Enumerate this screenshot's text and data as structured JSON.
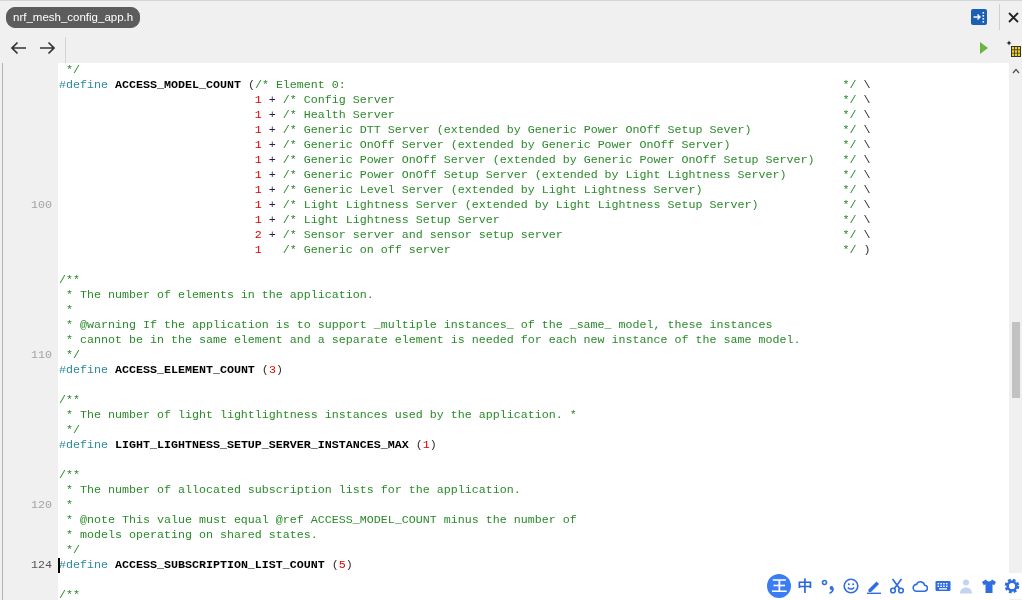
{
  "tab": {
    "label": "nrf_mesh_config_app.h",
    "selected": true
  },
  "editor": {
    "lines": [
      {
        "code": [
          {
            "kind": "comment",
            "text": " */"
          }
        ],
        "caret": false
      },
      {
        "code": [
          {
            "kind": "directive",
            "text": "#define "
          },
          {
            "kind": "macro",
            "text": "ACCESS_MODEL_COUNT"
          },
          {
            "kind": "plain",
            "text": " ("
          },
          {
            "kind": "comment",
            "text": "/* Element 0:"
          }
        ],
        "tail": [
          {
            "kind": "comment",
            "text": "*/"
          },
          {
            "kind": "plain",
            "text": " \\"
          }
        ],
        "caret": false
      },
      {
        "code": [
          {
            "kind": "number",
            "text": "                            1"
          },
          {
            "kind": "operator",
            "text": " + "
          },
          {
            "kind": "comment",
            "text": "/* Config Server"
          }
        ],
        "tail": [
          {
            "kind": "comment",
            "text": "*/"
          },
          {
            "kind": "plain",
            "text": " \\"
          }
        ],
        "caret": false
      },
      {
        "code": [
          {
            "kind": "number",
            "text": "                            1"
          },
          {
            "kind": "operator",
            "text": " + "
          },
          {
            "kind": "comment",
            "text": "/* Health Server"
          }
        ],
        "tail": [
          {
            "kind": "comment",
            "text": "*/"
          },
          {
            "kind": "plain",
            "text": " \\"
          }
        ],
        "caret": false
      },
      {
        "code": [
          {
            "kind": "number",
            "text": "                            1"
          },
          {
            "kind": "operator",
            "text": " + "
          },
          {
            "kind": "comment",
            "text": "/* Generic DTT Server (extended by Generic Power OnOff Setup Sever)"
          }
        ],
        "tail": [
          {
            "kind": "comment",
            "text": "*/"
          },
          {
            "kind": "plain",
            "text": " \\"
          }
        ],
        "caret": false
      },
      {
        "code": [
          {
            "kind": "number",
            "text": "                            1"
          },
          {
            "kind": "operator",
            "text": " + "
          },
          {
            "kind": "comment",
            "text": "/* Generic OnOff Server (extended by Generic Power OnOff Server)"
          }
        ],
        "tail": [
          {
            "kind": "comment",
            "text": "*/"
          },
          {
            "kind": "plain",
            "text": " \\"
          }
        ],
        "caret": false
      },
      {
        "code": [
          {
            "kind": "number",
            "text": "                            1"
          },
          {
            "kind": "operator",
            "text": " + "
          },
          {
            "kind": "comment",
            "text": "/* Generic Power OnOff Server (extended by Generic Power OnOff Setup Server)"
          }
        ],
        "tail": [
          {
            "kind": "comment",
            "text": "*/"
          },
          {
            "kind": "plain",
            "text": " \\"
          }
        ],
        "caret": false
      },
      {
        "code": [
          {
            "kind": "number",
            "text": "                            1"
          },
          {
            "kind": "operator",
            "text": " + "
          },
          {
            "kind": "comment",
            "text": "/* Generic Power OnOff Setup Server (extended by Light Lightness Server)"
          }
        ],
        "tail": [
          {
            "kind": "comment",
            "text": "*/"
          },
          {
            "kind": "plain",
            "text": " \\"
          }
        ],
        "caret": false
      },
      {
        "code": [
          {
            "kind": "number",
            "text": "                            1"
          },
          {
            "kind": "operator",
            "text": " + "
          },
          {
            "kind": "comment",
            "text": "/* Generic Level Server (extended by Light Lightness Server)"
          }
        ],
        "tail": [
          {
            "kind": "comment",
            "text": "*/"
          },
          {
            "kind": "plain",
            "text": " \\"
          }
        ],
        "caret": false
      },
      {
        "number": "100",
        "code": [
          {
            "kind": "number",
            "text": "                            1"
          },
          {
            "kind": "operator",
            "text": " + "
          },
          {
            "kind": "comment",
            "text": "/* Light Lightness Server (extended by Light Lightness Setup Server)"
          }
        ],
        "tail": [
          {
            "kind": "comment",
            "text": "*/"
          },
          {
            "kind": "plain",
            "text": " \\"
          }
        ],
        "caret": false
      },
      {
        "code": [
          {
            "kind": "number",
            "text": "                            1"
          },
          {
            "kind": "operator",
            "text": " + "
          },
          {
            "kind": "comment",
            "text": "/* Light Lightness Setup Server"
          }
        ],
        "tail": [
          {
            "kind": "comment",
            "text": "*/"
          },
          {
            "kind": "plain",
            "text": " \\"
          }
        ],
        "caret": false
      },
      {
        "code": [
          {
            "kind": "number",
            "text": "                            2"
          },
          {
            "kind": "operator",
            "text": " + "
          },
          {
            "kind": "comment",
            "text": "/* Sensor server and sensor setup server"
          }
        ],
        "tail": [
          {
            "kind": "comment",
            "text": "*/"
          },
          {
            "kind": "plain",
            "text": " \\"
          }
        ],
        "caret": false
      },
      {
        "code": [
          {
            "kind": "number",
            "text": "                            1"
          },
          {
            "kind": "comment",
            "text": "   /* Generic on off server"
          }
        ],
        "tail": [
          {
            "kind": "comment",
            "text": "*/"
          },
          {
            "kind": "plain",
            "text": " )"
          }
        ],
        "caret": false
      },
      {
        "caret": false
      },
      {
        "code": [
          {
            "kind": "comment",
            "text": "/**"
          }
        ],
        "caret": false
      },
      {
        "code": [
          {
            "kind": "comment",
            "text": " * The number of elements in the application."
          }
        ],
        "caret": false
      },
      {
        "code": [
          {
            "kind": "comment",
            "text": " *"
          }
        ],
        "caret": false
      },
      {
        "code": [
          {
            "kind": "comment",
            "text": " * @warning If the application is to support _multiple instances_ of the _same_ model, these instances"
          }
        ],
        "caret": false
      },
      {
        "code": [
          {
            "kind": "comment",
            "text": " * cannot be in the same element and a separate element is needed for each new instance of the same model."
          }
        ],
        "caret": false
      },
      {
        "number": "110",
        "code": [
          {
            "kind": "comment",
            "text": " */"
          }
        ],
        "caret": false
      },
      {
        "code": [
          {
            "kind": "directive",
            "text": "#define "
          },
          {
            "kind": "macro",
            "text": "ACCESS_ELEMENT_COUNT"
          },
          {
            "kind": "plain",
            "text": " ("
          },
          {
            "kind": "number",
            "text": "3"
          },
          {
            "kind": "plain",
            "text": ")"
          }
        ],
        "caret": false
      },
      {
        "caret": false
      },
      {
        "code": [
          {
            "kind": "comment",
            "text": "/**"
          }
        ],
        "caret": false
      },
      {
        "code": [
          {
            "kind": "comment",
            "text": " * The number of light lightlightness instances used by the application. *"
          }
        ],
        "caret": false
      },
      {
        "code": [
          {
            "kind": "comment",
            "text": " */"
          }
        ],
        "caret": false
      },
      {
        "code": [
          {
            "kind": "directive",
            "text": "#define "
          },
          {
            "kind": "macro",
            "text": "LIGHT_LIGHTNESS_SETUP_SERVER_INSTANCES_MAX"
          },
          {
            "kind": "plain",
            "text": " ("
          },
          {
            "kind": "number",
            "text": "1"
          },
          {
            "kind": "plain",
            "text": ")"
          }
        ],
        "caret": false
      },
      {
        "caret": false
      },
      {
        "code": [
          {
            "kind": "comment",
            "text": "/**"
          }
        ],
        "caret": false
      },
      {
        "code": [
          {
            "kind": "comment",
            "text": " * The number of allocated subscription lists for the application."
          }
        ],
        "caret": false
      },
      {
        "number": "120",
        "code": [
          {
            "kind": "comment",
            "text": " *"
          }
        ],
        "caret": false
      },
      {
        "code": [
          {
            "kind": "comment",
            "text": " * @note This value must equal @ref ACCESS_MODEL_COUNT minus the number of"
          }
        ],
        "caret": false
      },
      {
        "code": [
          {
            "kind": "comment",
            "text": " * models operating on shared states."
          }
        ],
        "caret": false
      },
      {
        "code": [
          {
            "kind": "comment",
            "text": " */"
          }
        ],
        "caret": false
      },
      {
        "number": "124",
        "code": [
          {
            "kind": "directive",
            "text": "#define "
          },
          {
            "kind": "macro",
            "text": "ACCESS_SUBSCRIPTION_LIST_COUNT"
          },
          {
            "kind": "plain",
            "text": " ("
          },
          {
            "kind": "number",
            "text": "5"
          },
          {
            "kind": "plain",
            "text": ")"
          }
        ],
        "caret": true
      },
      {
        "caret": false
      },
      {
        "code": [
          {
            "kind": "comment",
            "text": "/**"
          }
        ],
        "caret": false
      }
    ]
  },
  "ime_toolbar": {
    "logo": "王",
    "mode": "中"
  }
}
